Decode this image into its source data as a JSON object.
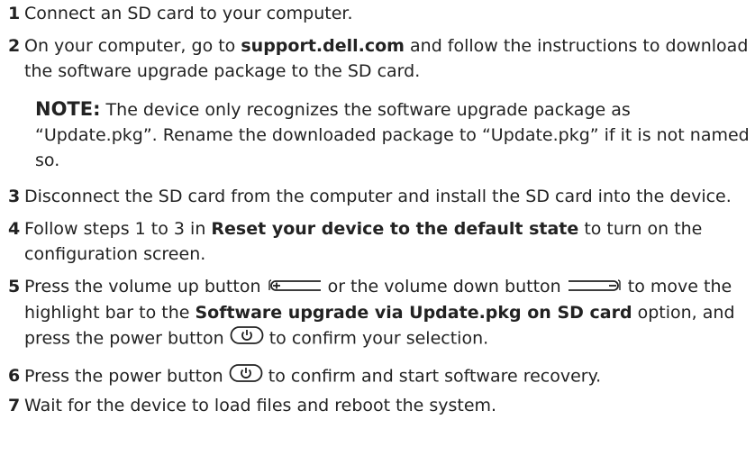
{
  "steps": [
    {
      "num": "1",
      "text": "Connect an SD card to your computer."
    },
    {
      "num": "2",
      "pre": "On your computer, go to ",
      "bold": "support.dell.com",
      "post": " and follow the instructions to download the software upgrade package to the SD card."
    },
    {
      "num": "3",
      "text": "Disconnect the SD card from the computer and install the SD card into the device."
    },
    {
      "num": "4",
      "pre": "Follow steps 1 to 3 in ",
      "bold": "Reset your device to the default state",
      "post": " to turn on the configuration screen."
    },
    {
      "num": "5",
      "part1": "Press the volume up button ",
      "part2": " or the volume down button ",
      "part3": " to move the highlight bar to the ",
      "bold": "Software upgrade via Update.pkg on SD card",
      "part4": " option, and press the power button ",
      "part5": " to confirm your selection."
    },
    {
      "num": "6",
      "part1": "Press the power button ",
      "part2": " to confirm and start software recovery."
    },
    {
      "num": "7",
      "text": "Wait for the device to load files and reboot the system."
    }
  ],
  "note": {
    "label": "NOTE:",
    "text": " The device only recognizes the software upgrade package as “Update.pkg”. Rename the downloaded package to “Update.pkg” if it is not named so."
  },
  "icons": {
    "volume_up": "volume-up-button-icon",
    "volume_down": "volume-down-button-icon",
    "power": "power-button-icon"
  }
}
